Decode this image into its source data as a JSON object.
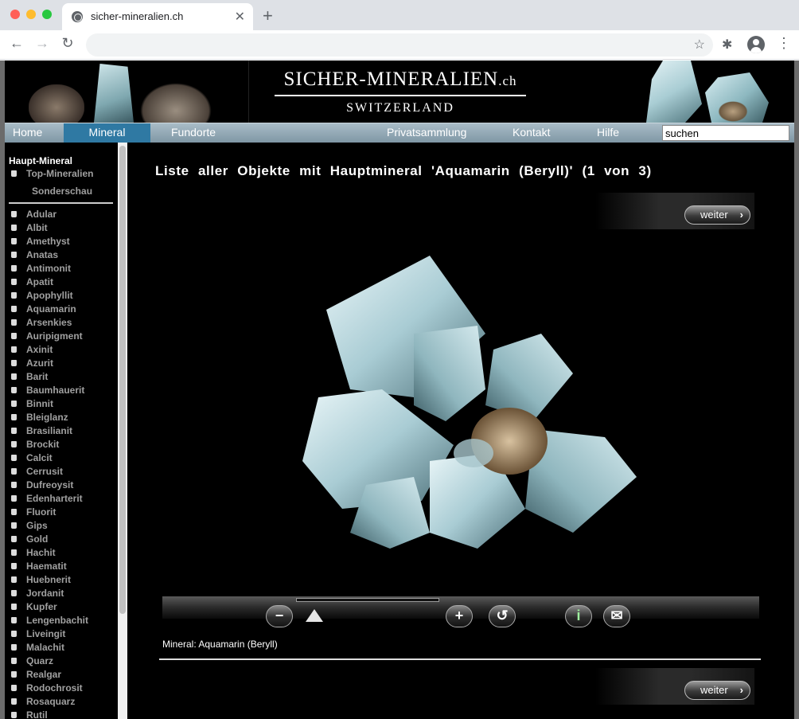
{
  "browser": {
    "tab_title": "sicher-mineralien.ch",
    "tab_close": "✕",
    "new_tab": "+",
    "back": "←",
    "forward": "→",
    "reload": "↻",
    "bookmark": "☆",
    "extensions": "✱",
    "menu": "⋮"
  },
  "site": {
    "logo_main": "SICHER-MINERALIEN",
    "logo_tld": ".ch",
    "logo_sub": "SWITZERLAND"
  },
  "nav": {
    "items": [
      {
        "label": "Home"
      },
      {
        "label": "Mineral"
      },
      {
        "label": "Fundorte"
      },
      {
        "label": "Privatsammlung"
      },
      {
        "label": "Kontakt"
      },
      {
        "label": "Hilfe"
      }
    ],
    "active": "Mineral",
    "search_value": "suchen"
  },
  "sidebar": {
    "heading": "Haupt-Mineral",
    "top_link": "Top-Mineralien",
    "special_link": "Sonderschau",
    "minerals": [
      "Adular",
      "Albit",
      "Amethyst",
      "Anatas",
      "Antimonit",
      "Apatit",
      "Apophyllit",
      "Aquamarin",
      "Arsenkies",
      "Auripigment",
      "Axinit",
      "Azurit",
      "Barit",
      "Baumhauerit",
      "Binnit",
      "Bleiglanz",
      "Brasilianit",
      "Brockit",
      "Calcit",
      "Cerrusit",
      "Dufreoysit",
      "Edenharterit",
      "Fluorit",
      "Gips",
      "Gold",
      "Hachit",
      "Haematit",
      "Huebnerit",
      "Jordanit",
      "Kupfer",
      "Lengenbachit",
      "Liveingit",
      "Malachit",
      "Quarz",
      "Realgar",
      "Rodochrosit",
      "Rosaquarz",
      "Rutil"
    ]
  },
  "content": {
    "heading": "Liste aller Objekte mit Hauptmineral 'Aquamarin (Beryll)' (1 von 3)",
    "next_label": "weiter",
    "next_chevron": "›",
    "caption": "Mineral: Aquamarin (Beryll)",
    "controls": {
      "zoom_out": "−",
      "zoom_in": "+",
      "rotate": "↺",
      "info": "i",
      "mail": "✉"
    }
  },
  "colors": {
    "nav_active": "#2f79a3",
    "nav_bar": "#8ea4b1",
    "page_bg": "#000000"
  }
}
